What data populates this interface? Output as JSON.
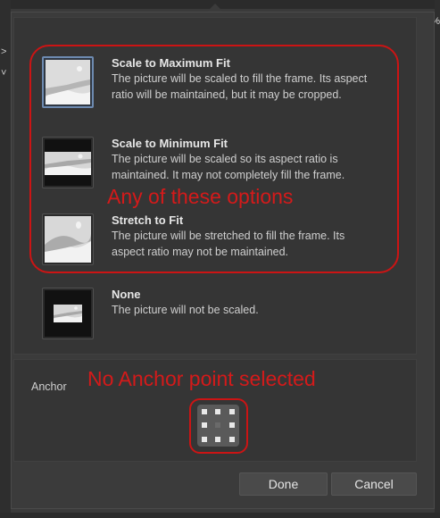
{
  "background": {
    "left_glyphs": [
      ">",
      "˅"
    ],
    "zoom_percent": "%"
  },
  "options": [
    {
      "title": "Scale to Maximum Fit",
      "description": "The picture will be scaled to fill the frame. Its aspect ratio will be maintained, but it may be cropped.",
      "selected": true,
      "icon": "scale-max-fit-icon"
    },
    {
      "title": "Scale to Minimum Fit",
      "description": "The picture will be scaled so its aspect ratio is maintained. It may not completely fill the frame.",
      "selected": false,
      "icon": "scale-min-fit-icon"
    },
    {
      "title": "Stretch to Fit",
      "description": "The picture will be stretched to fill the frame. Its aspect ratio may not be maintained.",
      "selected": false,
      "icon": "stretch-fit-icon"
    },
    {
      "title": "None",
      "description": "The picture will not be scaled.",
      "selected": false,
      "icon": "no-scale-icon"
    }
  ],
  "anchor": {
    "label": "Anchor"
  },
  "buttons": {
    "done": "Done",
    "cancel": "Cancel"
  },
  "annotations": {
    "options_note": "Any of these options",
    "anchor_note": "No Anchor point selected",
    "color": "#cc1414"
  }
}
